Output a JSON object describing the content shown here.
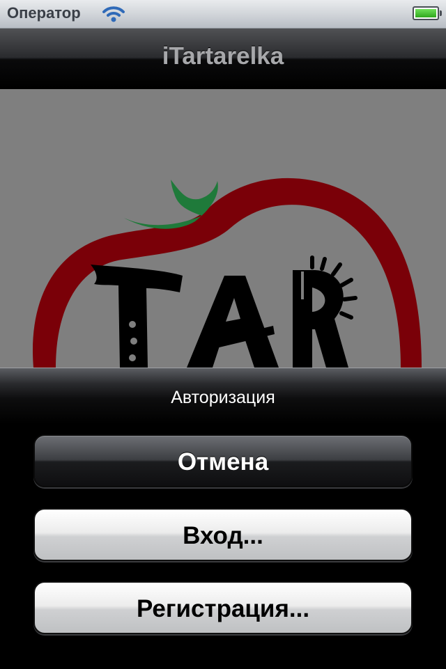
{
  "status_bar": {
    "carrier": "Оператор",
    "wifi_icon": "wifi-icon",
    "battery_icon": "battery-icon",
    "battery_level": 1.0
  },
  "nav_bar": {
    "title": "iTartarelka"
  },
  "content": {
    "logo_text": "TAR",
    "logo_colors": {
      "tomato": "#7a0008",
      "leaf": "#1f7a3a",
      "letters": "#000000"
    }
  },
  "action_sheet": {
    "title": "Авторизация",
    "buttons": {
      "cancel": "Отмена",
      "login": "Вход...",
      "register": "Регистрация..."
    }
  }
}
